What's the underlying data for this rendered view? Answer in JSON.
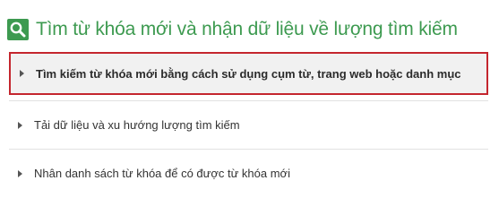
{
  "colors": {
    "accent_green": "#3d9a50",
    "highlight_red": "#c4262e",
    "text_dark": "#333333"
  },
  "header": {
    "icon": "search-icon",
    "title": "Tìm từ khóa mới và nhận dữ liệu về lượng tìm kiếm"
  },
  "options": [
    {
      "icon": "caret-right-icon",
      "label": "Tìm kiếm từ khóa mới bằng cách sử dụng cụm từ, trang web hoặc danh mục",
      "selected": true
    },
    {
      "icon": "caret-right-icon",
      "label": "Tải dữ liệu và xu hướng lượng tìm kiếm",
      "selected": false
    },
    {
      "icon": "caret-right-icon",
      "label": "Nhân danh sách từ khóa để có được từ khóa mới",
      "selected": false
    }
  ]
}
